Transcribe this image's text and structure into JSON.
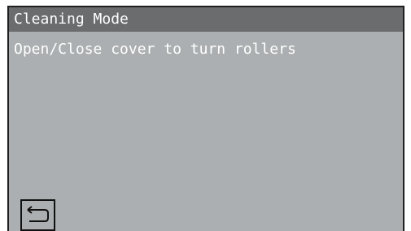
{
  "screen": {
    "title": "Cleaning Mode",
    "message": "Open/Close cover to turn rollers"
  },
  "controls": {
    "back_icon": "return-arrow-icon"
  },
  "colors": {
    "title_bar": "#6b6c6e",
    "background": "#acafb1",
    "text": "#ffffff",
    "border": "#1f1f1f"
  }
}
